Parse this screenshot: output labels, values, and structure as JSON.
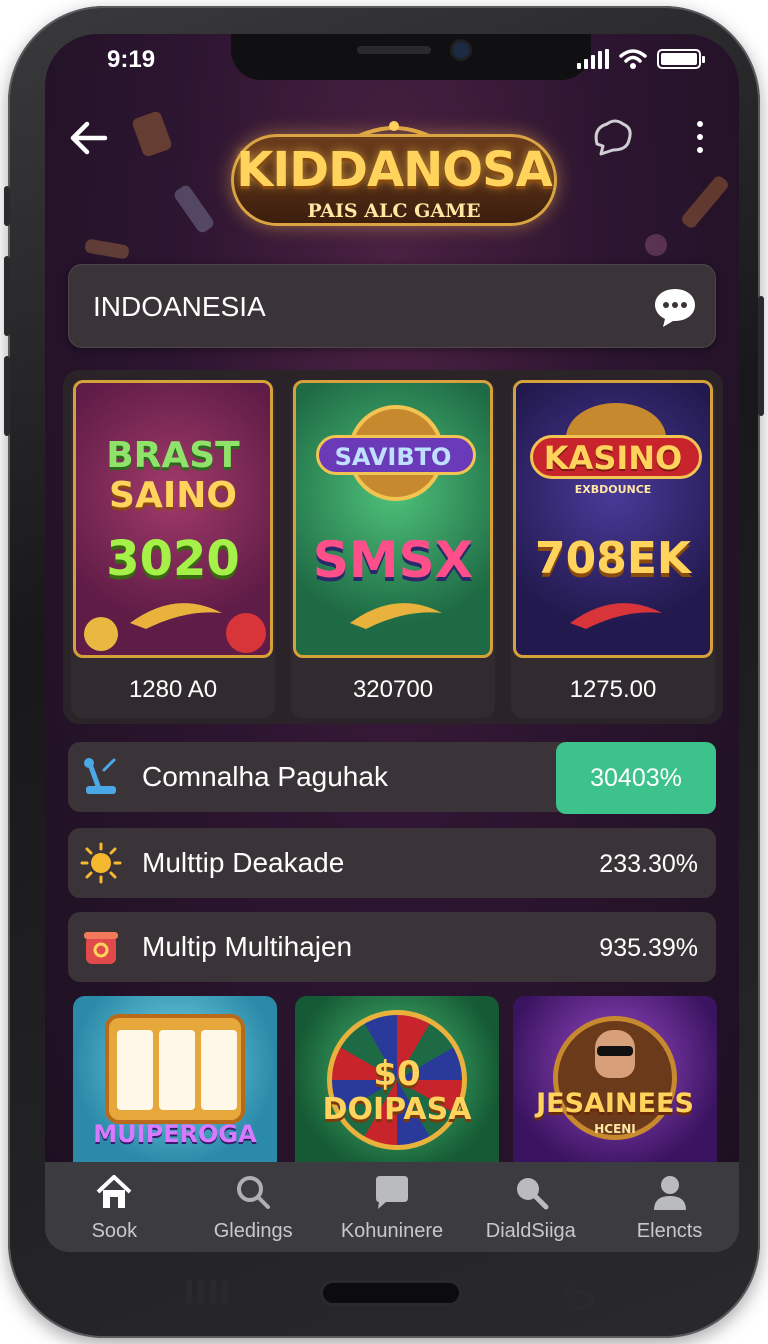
{
  "status_bar": {
    "time": "9:19"
  },
  "header": {
    "logo_title": "KIDDANOSA",
    "logo_subtitle": "PAIS ALC GAME"
  },
  "search": {
    "text": "INDOANESIA"
  },
  "featured_games": [
    {
      "line1": "BRAST",
      "line2": "SAINO",
      "line3": "3020",
      "price": "1280 A0"
    },
    {
      "line1": "SAVIBTO",
      "line2": "",
      "line3": "SMSX",
      "price": "320700"
    },
    {
      "line1": "KASINO",
      "line2": "EXBDOUNCE",
      "line3": "708EK",
      "price": "1275.00"
    }
  ],
  "rows": [
    {
      "label": "Comnalha Paguhak",
      "value": "30403%",
      "icon": "joystick-icon",
      "highlight": true
    },
    {
      "label": "Multtip Deakade",
      "value": "233.30%",
      "icon": "sun-icon",
      "highlight": false
    },
    {
      "label": "Multip Multihajen",
      "value": "935.39%",
      "icon": "pot-icon",
      "highlight": false
    }
  ],
  "bottom_games": [
    {
      "title": "MUIPEROGA"
    },
    {
      "title": "DOIPASA",
      "badge": "$0"
    },
    {
      "title": "JESAINEES",
      "subtitle": "HCENI"
    }
  ],
  "tabs": [
    {
      "label": "Sook",
      "icon": "home-icon"
    },
    {
      "label": "Gledings",
      "icon": "search-icon"
    },
    {
      "label": "Kohuninere",
      "icon": "chat-icon"
    },
    {
      "label": "DialdSiiga",
      "icon": "search-icon"
    },
    {
      "label": "Elencts",
      "icon": "person-icon"
    }
  ],
  "colors": {
    "background": "#2c1530",
    "accent_gold": "#d6a03a",
    "badge_green": "#3cc28a",
    "panel": "#3a3438",
    "tab_bar": "#3c3c40"
  }
}
